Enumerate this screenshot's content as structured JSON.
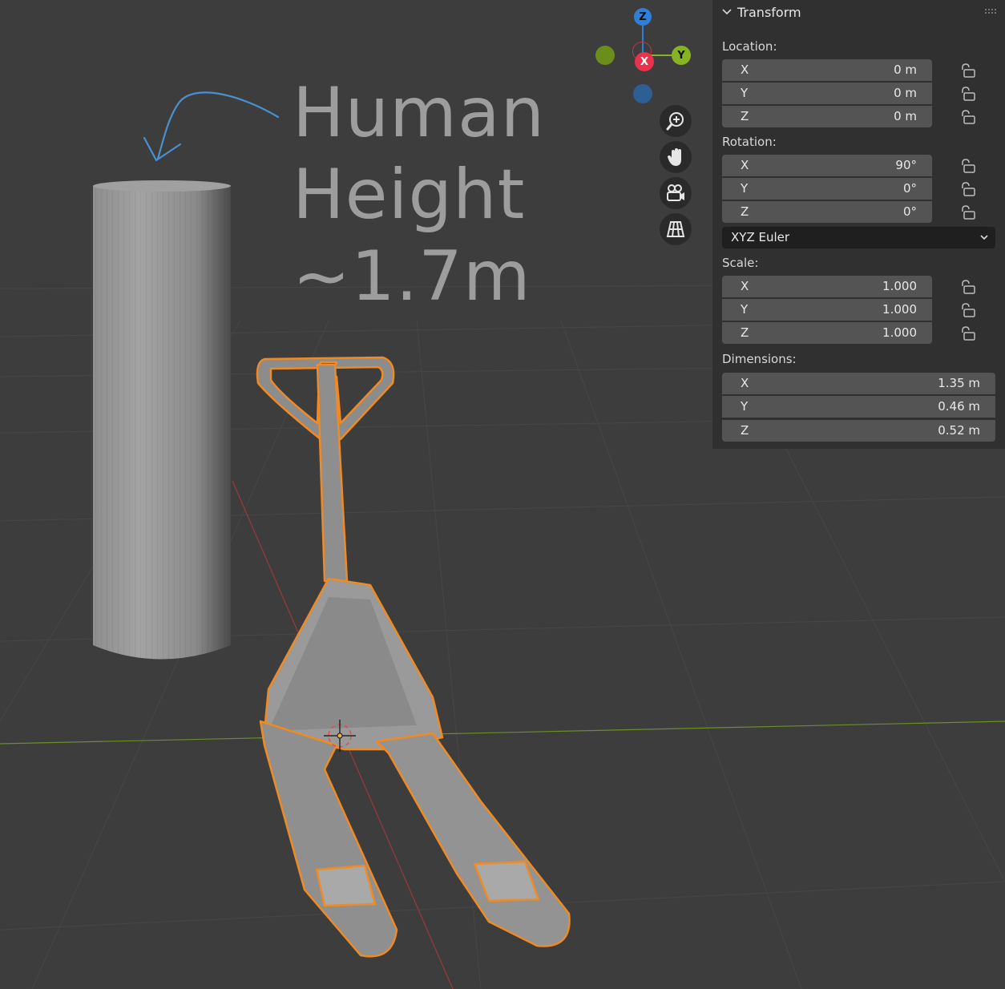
{
  "annotation": {
    "lines": [
      "Human",
      "Height",
      "~1.7m"
    ]
  },
  "gizmo": {
    "z_label": "Z",
    "y_label": "Y",
    "x_label": "X",
    "colors": {
      "z": "#2f7fd8",
      "y": "#86b321",
      "x": "#e8334f"
    }
  },
  "nav_buttons": [
    {
      "icon": "zoom-icon"
    },
    {
      "icon": "hand-pan-icon"
    },
    {
      "icon": "camera-icon"
    },
    {
      "icon": "ortho-grid-icon"
    }
  ],
  "transform_panel": {
    "title": "Transform",
    "location": {
      "label": "Location:",
      "rows": [
        {
          "axis": "X",
          "value": "0 m"
        },
        {
          "axis": "Y",
          "value": "0 m"
        },
        {
          "axis": "Z",
          "value": "0 m"
        }
      ]
    },
    "rotation": {
      "label": "Rotation:",
      "rows": [
        {
          "axis": "X",
          "value": "90°"
        },
        {
          "axis": "Y",
          "value": "0°"
        },
        {
          "axis": "Z",
          "value": "0°"
        }
      ],
      "mode": "XYZ Euler"
    },
    "scale": {
      "label": "Scale:",
      "rows": [
        {
          "axis": "X",
          "value": "1.000"
        },
        {
          "axis": "Y",
          "value": "1.000"
        },
        {
          "axis": "Z",
          "value": "1.000"
        }
      ]
    },
    "dimensions": {
      "label": "Dimensions:",
      "rows": [
        {
          "axis": "X",
          "value": "1.35 m"
        },
        {
          "axis": "Y",
          "value": "0.46 m"
        },
        {
          "axis": "Z",
          "value": "0.52 m"
        }
      ]
    }
  },
  "colors": {
    "selection_outline": "#f08a24",
    "panel_bg": "#303030",
    "field_bg": "#545454",
    "annotation_arrow": "#4a8fd0"
  }
}
